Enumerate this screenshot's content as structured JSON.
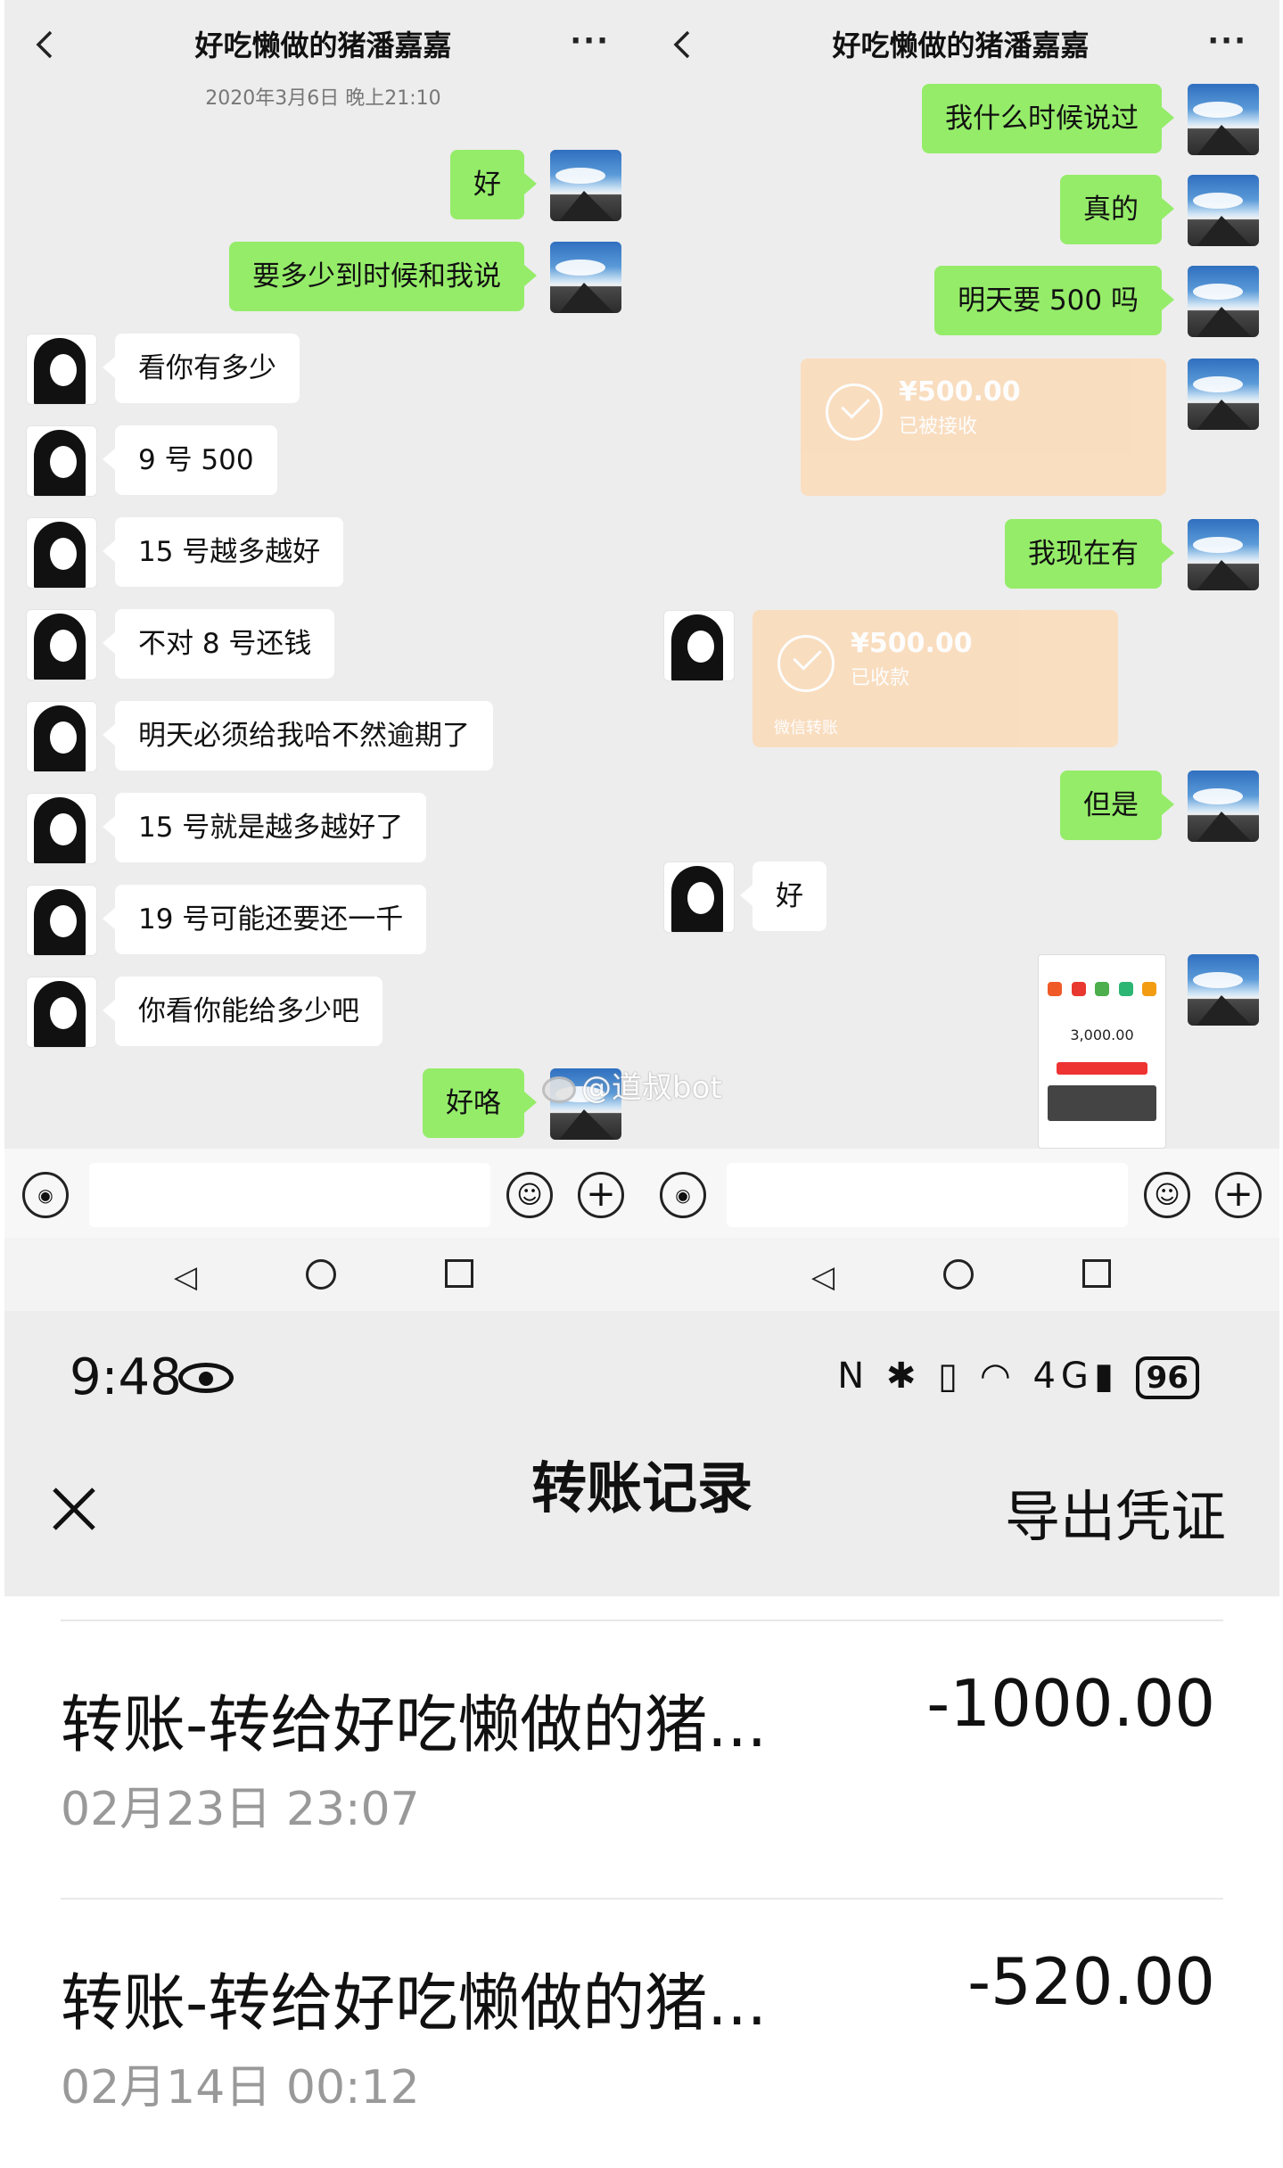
{
  "left_chat": {
    "title": "好吃懒做的猪潘嘉嘉",
    "more": "···",
    "date": "2020年3月6日 晚上21:10",
    "messages": [
      {
        "side": "right",
        "text": "好"
      },
      {
        "side": "right",
        "text": "要多少到时候和我说"
      },
      {
        "side": "left",
        "text": "看你有多少"
      },
      {
        "side": "left",
        "text": "9 号 500"
      },
      {
        "side": "left",
        "text": "15 号越多越好"
      },
      {
        "side": "left",
        "text": "不对 8 号还钱"
      },
      {
        "side": "left",
        "text": "明天必须给我哈不然逾期了"
      },
      {
        "side": "left",
        "text": "15 号就是越多越好了"
      },
      {
        "side": "left",
        "text": "19 号可能还要还一千"
      },
      {
        "side": "left",
        "text": "你看你能给多少吧"
      },
      {
        "side": "right",
        "text": "好咯"
      }
    ]
  },
  "right_chat": {
    "title": "好吃懒做的猪潘嘉嘉",
    "more": "···",
    "messages": [
      {
        "side": "right",
        "text": "我什么时候说过"
      },
      {
        "side": "right",
        "text": "真的"
      },
      {
        "side": "right",
        "text": "明天要 500 吗"
      },
      {
        "side": "right",
        "text": "我现在有"
      },
      {
        "side": "right",
        "text": "但是"
      },
      {
        "side": "left",
        "text": "好"
      }
    ],
    "transfer_sent": {
      "amount": "¥500.00",
      "status": "已被接收"
    },
    "transfer_received": {
      "amount": "¥500.00",
      "status": "已收款",
      "footer": "微信转账"
    },
    "thumbnail_amount": "3,000.00"
  },
  "watermark": "@道叔bot",
  "input_bar": {
    "voice_icon": "voice-icon",
    "emoji_icon": "emoji-icon",
    "plus_icon": "plus-icon"
  },
  "records": {
    "time": "9:48",
    "battery": "96",
    "network": "4G",
    "title": "转账记录",
    "export": "导出凭证",
    "items": [
      {
        "name": "转账-转给好吃懒做的猪...",
        "date": "02月23日 23:07",
        "amount": "-1000.00"
      },
      {
        "name": "转账-转给好吃懒做的猪...",
        "date": "02月14日 00:12",
        "amount": "-520.00"
      }
    ]
  },
  "colors": {
    "green_bubble": "#95ec69",
    "chat_bg": "#ededed",
    "transfer_card": "#fbdcbc"
  }
}
